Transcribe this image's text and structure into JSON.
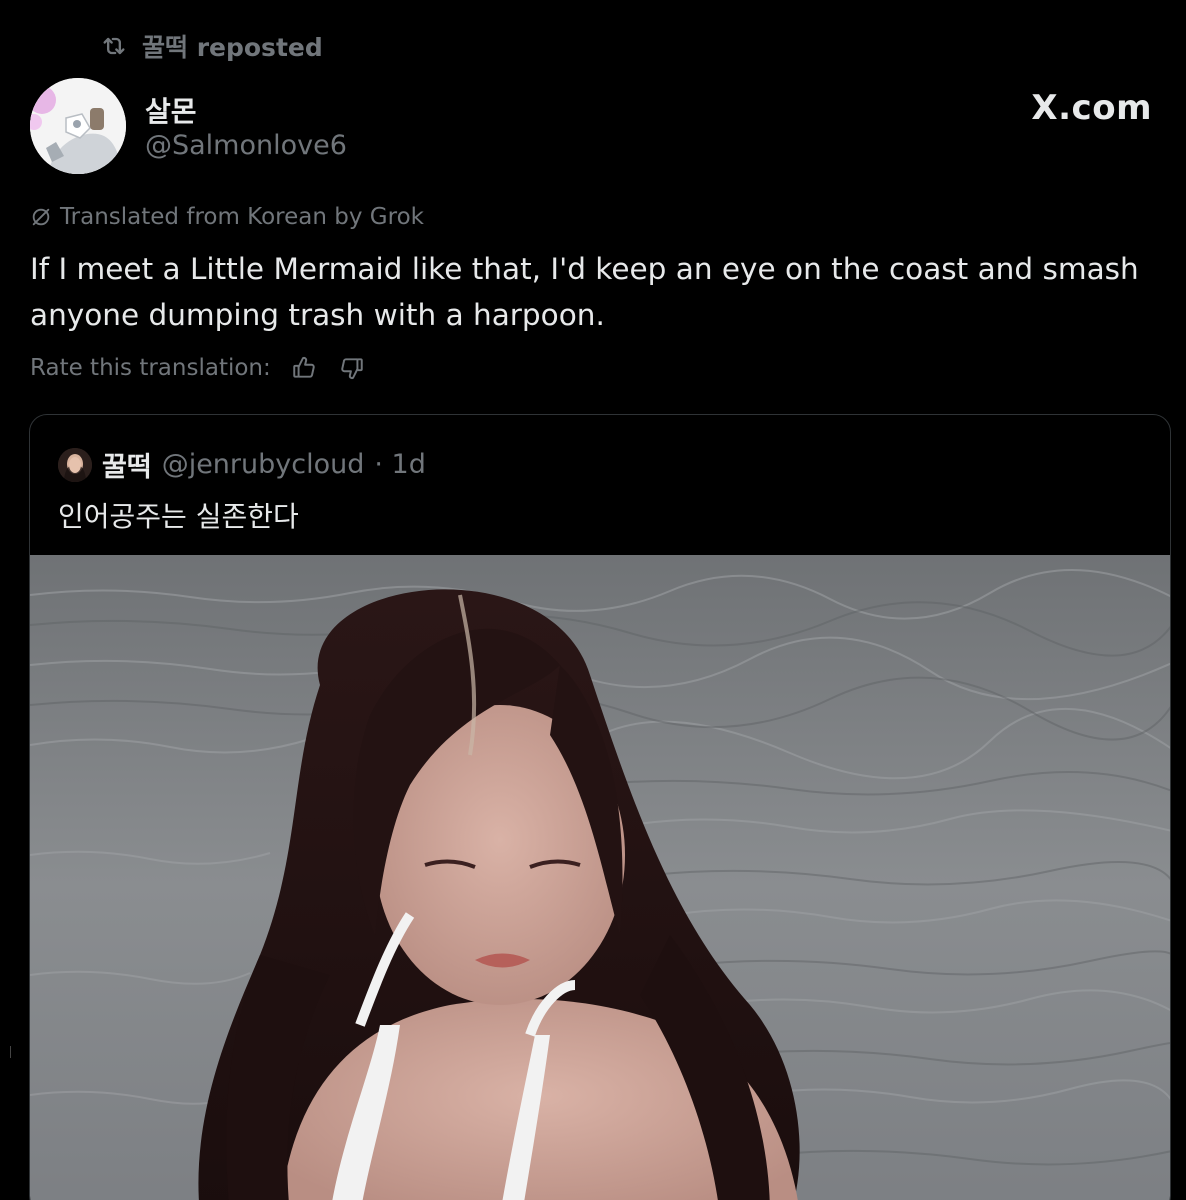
{
  "repost": {
    "label": "꿀떡 reposted",
    "icon": "repost-icon"
  },
  "author": {
    "name": "살몬",
    "handle": "@Salmonlove6",
    "avatar_icon": "avatar-image"
  },
  "source_logo": "X.com",
  "translation": {
    "note": "Translated from Korean by Grok",
    "icon": "grok-icon"
  },
  "tweet": {
    "text": "If I meet a Little Mermaid like that, I'd keep an eye on the coast and smash anyone dumping trash with a harpoon."
  },
  "rate": {
    "label": "Rate this translation:",
    "up_icon": "thumbs-up-icon",
    "down_icon": "thumbs-down-icon"
  },
  "quote": {
    "name": "꿀떡",
    "handle": "@jenrubycloud",
    "time": "· 1d",
    "text": "인어공주는 실존한다",
    "media_icon": "photo-woman-at-sea"
  },
  "colors": {
    "background": "#000000",
    "text_primary": "#e7e9ea",
    "text_secondary": "#71767b",
    "border": "#2f3336"
  }
}
